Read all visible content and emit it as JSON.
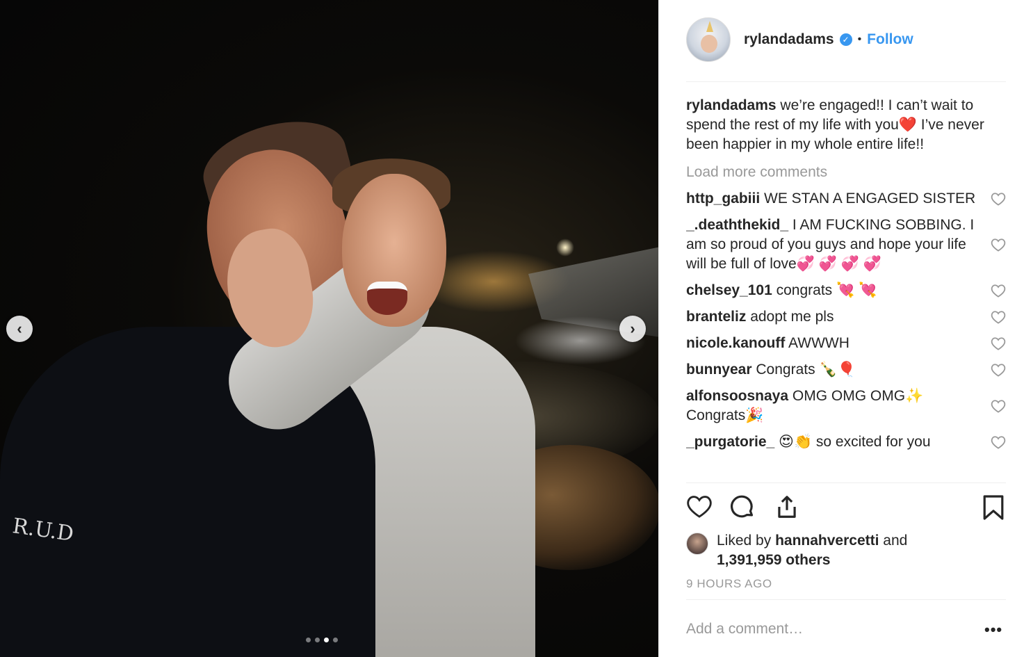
{
  "post": {
    "username": "rylandadams",
    "follow_label": "Follow",
    "separator": "•",
    "verified_icon": "✓",
    "caption_user": "rylandadams",
    "caption_text": "we’re engaged!! I can’t wait to spend the rest of my life with you❤️  I’ve never been happier in my whole entire life!!",
    "load_more": "Load more comments",
    "comments": [
      {
        "user": "http_gabiii",
        "text": "WE STAN A ENGAGED SISTER"
      },
      {
        "user": "_.deaththekid_",
        "text": "I AM FUCKING SOBBING. I am so proud of you guys and hope your life will be full of love💞 💞 💞 💞"
      },
      {
        "user": "chelsey_101",
        "text": "congrats 💘 💘"
      },
      {
        "user": "branteliz",
        "text": "adopt me pls"
      },
      {
        "user": "nicole.kanouff",
        "text": "AWWWH"
      },
      {
        "user": "bunnyear",
        "text": "Congrats 🍾🎈"
      },
      {
        "user": "alfonsoosnaya",
        "text": "OMG OMG OMG✨ Congrats🎉"
      },
      {
        "user": "_purgatorie_",
        "text": "😍👏 so excited for you"
      }
    ],
    "liked_by_prefix": "Liked by",
    "liked_by_user": "hannahvercetti",
    "liked_by_and": "and",
    "likes_count": "1,391,959 others",
    "time_ago": "9 HOURS AGO",
    "add_comment_placeholder": "Add a comment…",
    "more_options": "•••"
  },
  "carousel": {
    "prev_icon": "‹",
    "next_icon": "›",
    "slide_count": 4,
    "active_slide": 3
  },
  "photo": {
    "sleeve_text": "R.U.D"
  },
  "colors": {
    "accent": "#3897f0",
    "text": "#262626",
    "muted": "#999999"
  }
}
